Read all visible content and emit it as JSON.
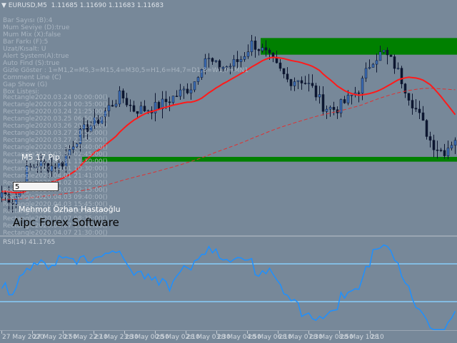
{
  "header": {
    "symbol": "EURUSD,M5",
    "quote": "1.11685 1.11690 1.11683 1.11683",
    "menu_icon": "triangle-down-icon"
  },
  "settings": [
    "Bar Sayısı (B):4",
    "Mum Seviye (D):true",
    "Mum Mix (X):false",
    "Bar Farkı (F):5",
    " Uzat/Kısalt: U",
    " Alert System(A):true",
    " Auto Find (S):true",
    " Gizle Göster : 1=M1,2=M5,3=M15,4=M30,5=H1,6=H4,7=D1,8=W1,9=MN1",
    " Comment Line (C)",
    " Gap Show (G)",
    " Box Listesi:"
  ],
  "boxes": [
    "Rectangle2020.03.24 00:00:00()",
    "Rectangle2020.03.24 00:35:00()",
    "Rectangle2020.03.24 21:25:00()",
    "Rectangle2020.03.25 06:50:00()",
    "Rectangle2020.03.26 20:10:00()",
    "Rectangle2020.03.27 20:50:00()",
    "Rectangle2020.03.27 21:55:00()",
    "Rectangle2020.03.30 10:40:00()",
    "Rectangle2020.03.31 02:45:00()",
    "Rectangle2020.03.31 11:30:00()",
    "Rectangle2020.04.01 10:30:00()",
    "Rectangle2020.04.01 21:41:00()",
    "Rectangle2020.04.02 03:55:00()",
    "Rectangle2020.04.02 12:15:00()",
    "Rectangle2020.04.03 09:40:00()",
    "Rectangle2020.04.03 15:45:00()",
    "Rectangle2020.04.06 20:35:00()",
    "Rectangle2020.04.07 08:35:00()",
    "Rectangle2020.04.07 15:20:00()",
    "Rectangle2020.04.07 21:30:00()"
  ],
  "overlay": {
    "pip_label": "M5 17 Pip",
    "box_label": "5",
    "author": "Mehmot Özhan Hastaoğlu",
    "brand": "Aipc Forex Software"
  },
  "rsi": {
    "label": "RSI(14) 41.1765",
    "period": 14,
    "levels": [
      70,
      30
    ],
    "range": [
      0,
      100
    ],
    "line_color": "#1e90ff",
    "level_color": "#87cefa"
  },
  "time_axis": [
    "27 May 2020",
    "27 May 20:50",
    "27 May 22:10",
    "27 May 23:30",
    "28 May 00:50",
    "28 May 02:10",
    "28 May 03:30",
    "28 May 04:50",
    "28 May 06:10",
    "28 May 07:30",
    "28 May 08:50",
    "28 May 10:10",
    "28"
  ],
  "colors": {
    "background": "#778899",
    "bull_candle": "#3a6cb5",
    "bear_candle": "#0d1630",
    "zone": "#008000",
    "ma_fast": "#ff1a1a",
    "ma_slow": "#e03030"
  },
  "price_chart": {
    "closes": [
      1.115,
      1.1146,
      1.1159,
      1.1162,
      1.1161,
      1.1162,
      1.1171,
      1.1177,
      1.118,
      1.1186,
      1.1191,
      1.1185,
      1.1185,
      1.1186,
      1.1189,
      1.1192,
      1.1195,
      1.1207,
      1.1203,
      1.1203,
      1.1206,
      1.1213,
      1.1209,
      1.1203,
      1.1197,
      1.1198,
      1.1194,
      1.1186,
      1.1185,
      1.1189,
      1.1194,
      1.1206,
      1.1209,
      1.1203,
      1.1192,
      1.1182,
      1.1171,
      1.1167,
      1.1173
    ],
    "zones": [
      {
        "low": 1.1208,
        "high": 1.1215
      },
      {
        "low": 1.1163,
        "high": 1.1165
      }
    ],
    "ma_fast_period": 20,
    "ma_slow_period": 100
  }
}
